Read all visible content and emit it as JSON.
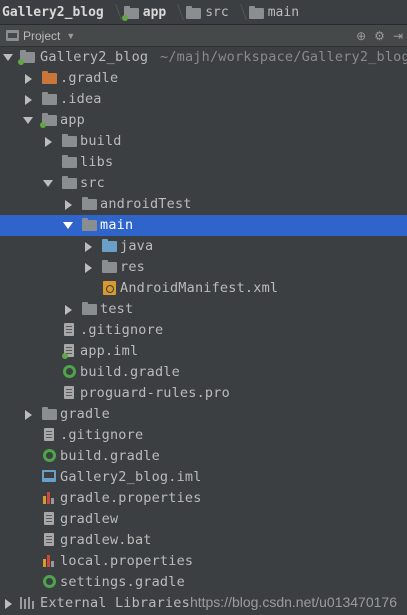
{
  "breadcrumb": {
    "items": [
      "Gallery2_blog",
      "app",
      "src",
      "main"
    ]
  },
  "panel": {
    "title": "Project"
  },
  "tree": {
    "project_root": "Gallery2_blog",
    "project_root_path": "~/majh/workspace/Gallery2_blog",
    "gradle_dir": ".gradle",
    "idea_dir": ".idea",
    "app": "app",
    "build": "build",
    "libs": "libs",
    "src": "src",
    "android_test": "androidTest",
    "main": "main",
    "java": "java",
    "res": "res",
    "manifest": "AndroidManifest.xml",
    "test": "test",
    "app_gitignore": ".gitignore",
    "app_iml": "app.iml",
    "app_build_gradle": "build.gradle",
    "proguard": "proguard-rules.pro",
    "gradle_folder": "gradle",
    "root_gitignore": ".gitignore",
    "root_build_gradle": "build.gradle",
    "root_iml": "Gallery2_blog.iml",
    "gradle_properties": "gradle.properties",
    "gradlew": "gradlew",
    "gradlew_bat": "gradlew.bat",
    "local_properties": "local.properties",
    "settings_gradle": "settings.gradle",
    "external_libraries": "External Libraries"
  },
  "watermark": "https://blog.csdn.net/u013470176",
  "colors": {
    "background": "#3c3f41",
    "selection": "#2f65ca",
    "text": "#bbbbbb",
    "excluded_folder": "#c8763a",
    "source_folder": "#6a9fc8",
    "gradle": "#4fa34a"
  },
  "icons": {
    "project_view": "project-icon",
    "folder": "folder-icon",
    "module": "module-folder-icon",
    "source_folder": "source-folder-icon",
    "file": "text-file-icon",
    "gradle": "gradle-icon",
    "manifest": "android-manifest-icon",
    "properties": "properties-icon",
    "iml": "module-file-icon",
    "libraries": "external-libraries-icon"
  }
}
